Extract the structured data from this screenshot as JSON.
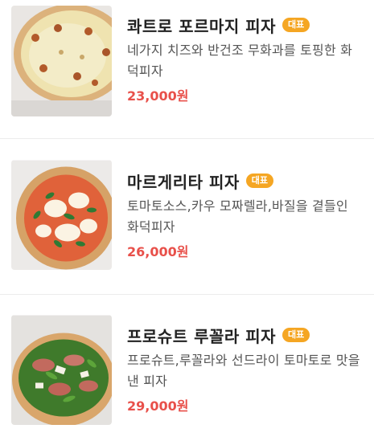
{
  "menu": {
    "items": [
      {
        "name": "콰트로 포르마지 피자",
        "badge": "대표",
        "description": "네가지 치즈와 반건조 무화과를 토핑한 화덕피자",
        "price": "23,000원",
        "image_icon": "pizza-quattro-formaggi"
      },
      {
        "name": "마르게리타 피자",
        "badge": "대표",
        "description": "토마토소스,카우 모짜렐라,바질을 곁들인 화덕피자",
        "price": "26,000원",
        "image_icon": "pizza-margherita"
      },
      {
        "name": "프로슈트 루꼴라 피자",
        "badge": "대표",
        "description": "프로슈트,루꼴라와 선드라이 토마토로 맛을 낸 피자",
        "price": "29,000원",
        "image_icon": "pizza-prosciutto-rucola"
      }
    ]
  },
  "colors": {
    "badge": "#f5a623",
    "price": "#e8504a",
    "divider": "#ececec"
  }
}
